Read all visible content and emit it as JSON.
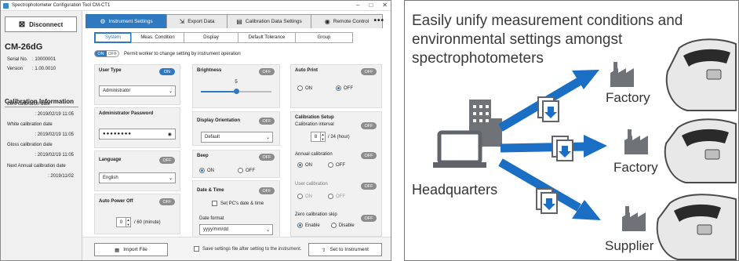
{
  "window": {
    "title": "Spectrophotometer Configuration Tool CM-CT1"
  },
  "sidebar": {
    "disconnect_label": "Disconnect",
    "model": "CM-26dG",
    "serial_label": "Serial No.",
    "serial_value": ": 10000001",
    "version_label": "Version",
    "version_value": ": 1.00.0010",
    "calibration_heading": "Calibration Information",
    "calibrations": [
      {
        "label": "Zero calibration date",
        "value": ": 2019/02/19 11:05"
      },
      {
        "label": "White calibration date",
        "value": ": 2019/02/19 11:05"
      },
      {
        "label": "Gloss calibration date",
        "value": ": 2019/02/19 11:05"
      },
      {
        "label": "Next Annual calibration date",
        "value": ": 2019/11/02"
      }
    ]
  },
  "tabs": [
    {
      "label": "Instrument Settings",
      "icon": "gear-icon"
    },
    {
      "label": "Export Data",
      "icon": "export-icon"
    },
    {
      "label": "Calibration Data Settings",
      "icon": "calibration-icon"
    },
    {
      "label": "Remote Control",
      "icon": "remote-icon"
    }
  ],
  "subtabs": [
    "System",
    "Meas. Condition",
    "Display",
    "Default Tolerance",
    "Group"
  ],
  "permit": {
    "toggle_on": "ON",
    "toggle_off": "OFF",
    "label": "Permit worker to change setting by instrument operation"
  },
  "user_type": {
    "title": "User Type",
    "state": "ON",
    "value": "Administrator"
  },
  "admin_password": {
    "title": "Administrator Password",
    "value": "●●●●●●●●"
  },
  "language": {
    "title": "Language",
    "state": "OFF",
    "value": "English"
  },
  "auto_power_off": {
    "title": "Auto Power Off",
    "state": "OFF",
    "value": "0",
    "unit": "/ 60 (minute)"
  },
  "brightness": {
    "title": "Brightness",
    "state": "OFF",
    "value": "5",
    "level_fraction": 0.5
  },
  "display_orientation": {
    "title": "Display Orientation",
    "state": "OFF",
    "value": "Default"
  },
  "beep": {
    "title": "Beep",
    "state": "OFF",
    "on_label": "ON",
    "off_label": "OFF",
    "selected": "ON"
  },
  "date_time": {
    "title": "Date & Time",
    "state": "OFF",
    "set_pc_label": "Set PC's date & time",
    "format_label": "Date format",
    "format_value": "yyyy/mm/dd"
  },
  "auto_print": {
    "title": "Auto Print",
    "state": "OFF",
    "on_label": "ON",
    "off_label": "OFF",
    "selected": "OFF"
  },
  "calibration_setup": {
    "title": "Calibration Setup",
    "interval_label": "Calibration interval",
    "interval_state": "OFF",
    "interval_value": "8",
    "interval_unit": "/ 24 (hour)",
    "annual_label": "Annual calibration",
    "annual_state": "OFF",
    "annual_on": "ON",
    "annual_off": "OFF",
    "user_label": "User calibration",
    "user_state": "OFF",
    "user_on": "ON",
    "user_off": "OFF",
    "zero_skip_label": "Zero calibration skip",
    "zero_skip_state": "OFF",
    "zero_enable": "Enable",
    "zero_disable": "Disable"
  },
  "bottom": {
    "import_label": "Import File",
    "save_label": "Save settings file after setting to the instrument.",
    "set_label": "Set to Instrument"
  },
  "infographic": {
    "headline": "Easily unify measurement conditions and environmental settings amongst spectrophotometers",
    "headquarters": "Headquarters",
    "factory1": "Factory",
    "factory2": "Factory",
    "supplier": "Supplier",
    "accent": "#1a6fc4"
  }
}
